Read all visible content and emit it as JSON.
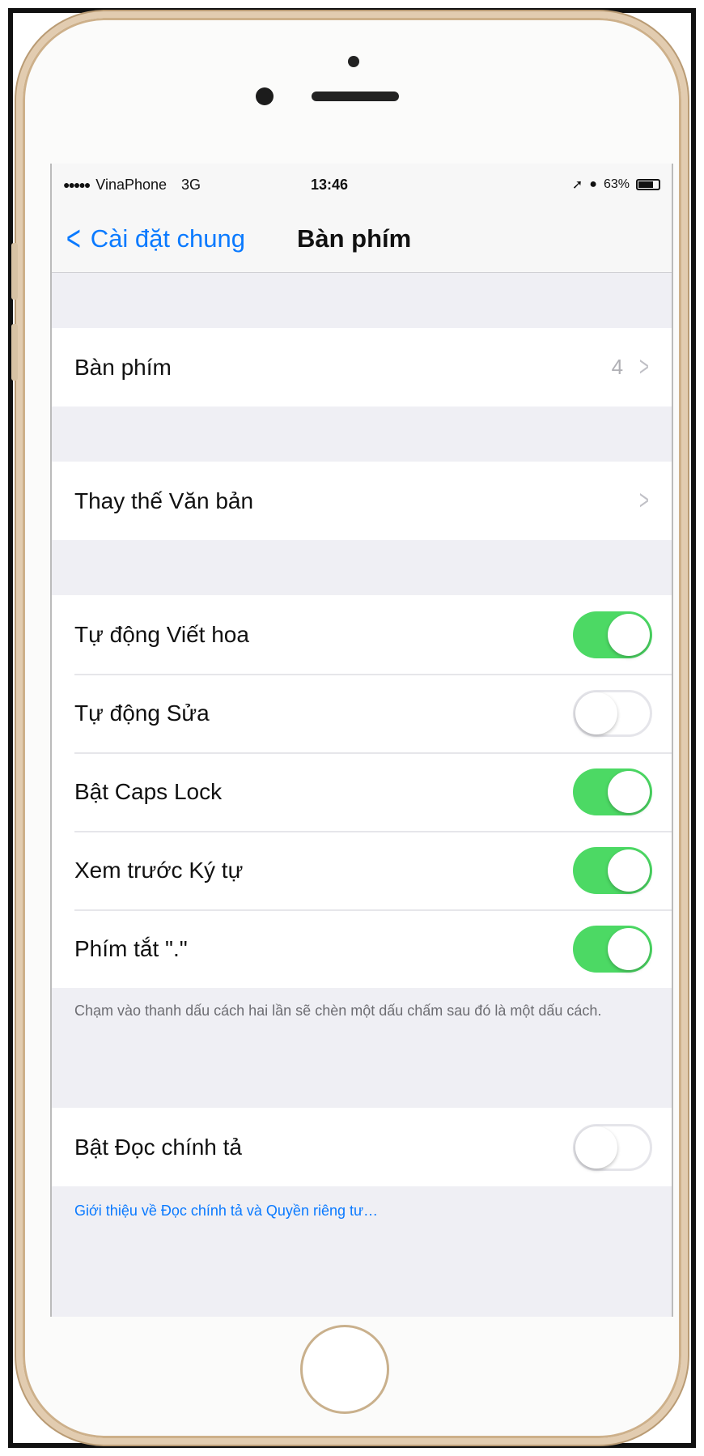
{
  "status_bar": {
    "signal": "●●●●●",
    "carrier": "VinaPhone",
    "network": "3G",
    "time": "13:46",
    "battery_percent": "63%"
  },
  "nav": {
    "back_label": "Cài đặt chung",
    "title": "Bàn phím"
  },
  "groups": {
    "keyboards": {
      "label": "Bàn phím",
      "count": "4"
    },
    "text_replacement": {
      "label": "Thay thế Văn bản"
    }
  },
  "toggles": [
    {
      "label": "Tự động Viết hoa",
      "on": true
    },
    {
      "label": "Tự động Sửa",
      "on": false
    },
    {
      "label": "Bật Caps Lock",
      "on": true
    },
    {
      "label": "Xem trước Ký tự",
      "on": true
    },
    {
      "label": "Phím tắt \".\"",
      "on": true
    }
  ],
  "shortcut_note": "Chạm vào thanh dấu cách hai lần sẽ chèn một dấu chấm sau đó là một dấu cách.",
  "dictation": {
    "label": "Bật Đọc chính tả",
    "on": false
  },
  "dictation_link": "Giới thiệu về Đọc chính tả và Quyền riêng tư…",
  "colors": {
    "accent": "#0a7aff",
    "toggle_on": "#4cd964",
    "phone_trim": "#e2ccb0"
  }
}
